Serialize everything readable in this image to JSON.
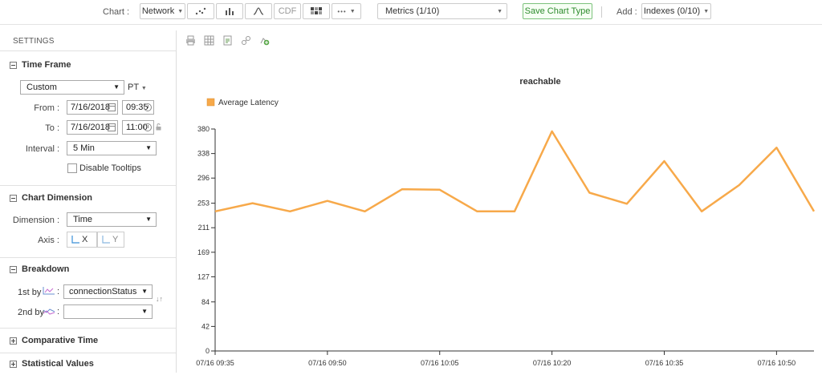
{
  "toolbar": {
    "chart_label": "Chart :",
    "network": "Network",
    "cdf": "CDF",
    "more": "•••",
    "metrics": "Metrics (1/10)",
    "save_chart_type": "Save Chart Type",
    "add_label": "Add :",
    "indexes": "Indexes (0/10)"
  },
  "sidebar": {
    "title": "SETTINGS",
    "time_frame": {
      "heading": "Time Frame",
      "range": "Custom",
      "tz": "PT",
      "from_label": "From :",
      "from_date": "7/16/2018",
      "from_time": "09:35",
      "to_label": "To :",
      "to_date": "7/16/2018",
      "to_time": "11:00",
      "interval_label": "Interval :",
      "interval": "5 Min",
      "disable_tooltips": "Disable Tooltips"
    },
    "chart_dimension": {
      "heading": "Chart Dimension",
      "dimension_label": "Dimension :",
      "dimension": "Time",
      "axis_label": "Axis :",
      "axis_x": "X",
      "axis_y": "Y"
    },
    "breakdown": {
      "heading": "Breakdown",
      "first_label": "1st by",
      "first_value": "connectionStatus",
      "second_label": "2nd by",
      "second_value": ""
    },
    "comparative_time": "Comparative Time",
    "statistical_values": "Statistical Values"
  },
  "chart_data": {
    "type": "line",
    "title": "reachable",
    "xlabel": "",
    "ylabel": "",
    "x": [
      "07/16 09:35",
      "07/16 09:40",
      "07/16 09:45",
      "07/16 09:50",
      "07/16 09:55",
      "07/16 10:00",
      "07/16 10:05",
      "07/16 10:10",
      "07/16 10:15",
      "07/16 10:20",
      "07/16 10:25",
      "07/16 10:30",
      "07/16 10:35",
      "07/16 10:40",
      "07/16 10:45",
      "07/16 10:50",
      "07/16 10:55"
    ],
    "x_tick_labels": [
      "07/16 09:35",
      "07/16 09:50",
      "07/16 10:05",
      "07/16 10:20",
      "07/16 10:35",
      "07/16 10:50"
    ],
    "y_ticks": [
      0,
      42,
      84,
      127,
      169,
      211,
      253,
      296,
      338,
      380
    ],
    "ylim": [
      0,
      380
    ],
    "series": [
      {
        "name": "Average Latency",
        "color": "#f7a94a",
        "values": [
          239,
          253,
          239,
          257,
          239,
          277,
          276,
          239,
          239,
          376,
          271,
          252,
          325,
          239,
          284,
          348,
          239
        ]
      }
    ],
    "legend_position": "top-left",
    "grid": false
  }
}
